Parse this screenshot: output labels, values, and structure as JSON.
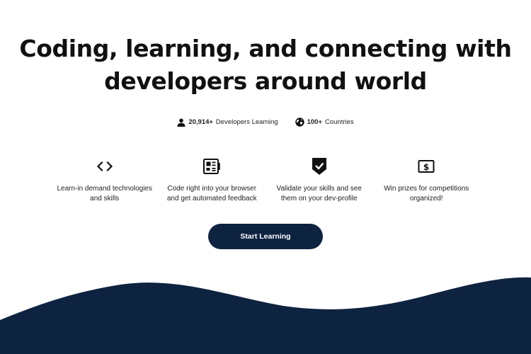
{
  "hero": {
    "title_line1": "Coding, learning, and connecting with",
    "title_line2": "developers around world"
  },
  "stats": {
    "developers_count": "20,914+",
    "developers_label": "Developers Learning",
    "countries_count": "100+",
    "countries_label": "Countries"
  },
  "features": [
    {
      "icon": "code-brackets-icon",
      "text": "Learn-in demand technologies\nand skills"
    },
    {
      "icon": "browser-editor-icon",
      "text": "Code right into your browser\nand get automated feedback"
    },
    {
      "icon": "shield-check-icon",
      "text": "Validate your skills and see\nthem on your dev-profile"
    },
    {
      "icon": "prize-dollar-icon",
      "text": "Win prizes for competitions\norganized!"
    }
  ],
  "cta": {
    "label": "Start Learning"
  },
  "colors": {
    "navy": "#0e2340",
    "text": "#111111",
    "background": "#ffffff"
  }
}
